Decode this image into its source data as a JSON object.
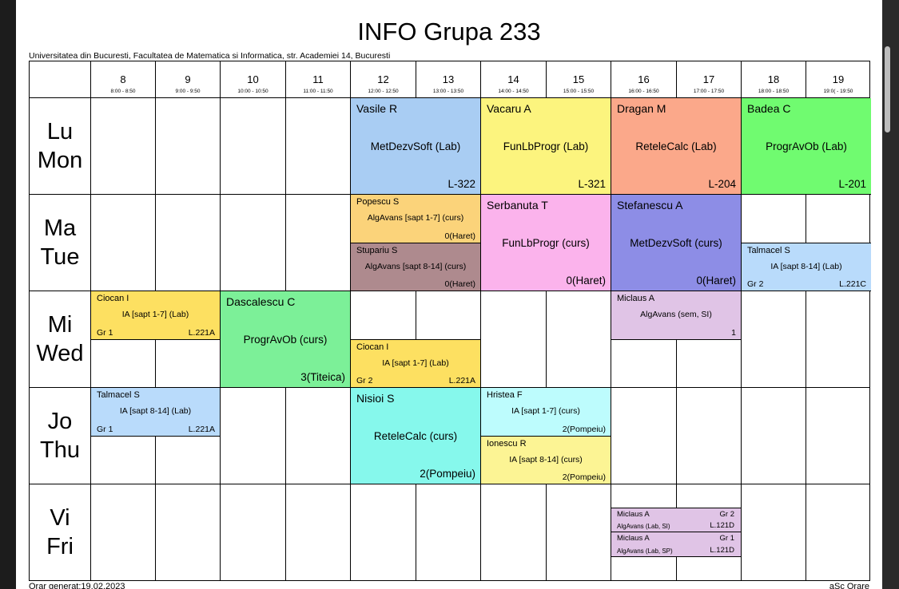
{
  "title": "INFO Grupa 233",
  "subtitle": "Universitatea din Bucuresti, Facultatea de Matematica si Informatica, str. Academiei 14, Bucuresti",
  "hours": [
    {
      "num": "8",
      "time": "8:00 - 8:50"
    },
    {
      "num": "9",
      "time": "9:00 - 9:50"
    },
    {
      "num": "10",
      "time": "10:00 - 10:50"
    },
    {
      "num": "11",
      "time": "11:00 - 11:50"
    },
    {
      "num": "12",
      "time": "12:00 - 12:50"
    },
    {
      "num": "13",
      "time": "13:00 - 13:50"
    },
    {
      "num": "14",
      "time": "14:00 - 14:50"
    },
    {
      "num": "15",
      "time": "15:00 - 15:50"
    },
    {
      "num": "16",
      "time": "16:00 - 16:50"
    },
    {
      "num": "17",
      "time": "17:00 - 17:50"
    },
    {
      "num": "18",
      "time": "18:00 - 18:50"
    },
    {
      "num": "19",
      "time": "19:0( - 19:50"
    }
  ],
  "days": [
    {
      "ro": "Lu",
      "en": "Mon"
    },
    {
      "ro": "Ma",
      "en": "Tue"
    },
    {
      "ro": "Mi",
      "en": "Wed"
    },
    {
      "ro": "Jo",
      "en": "Thu"
    },
    {
      "ro": "Vi",
      "en": "Fri"
    }
  ],
  "activities": {
    "mon_vasile": {
      "prof": "Vasile R",
      "subject": "MetDezvSoft (Lab)",
      "room": "L-322",
      "color": "#a9cdf3"
    },
    "mon_vacaru": {
      "prof": "Vacaru A",
      "subject": "FunLbProgr (Lab)",
      "room": "L-321",
      "color": "#fcf47e"
    },
    "mon_dragan": {
      "prof": "Dragan M",
      "subject": "ReteleCalc (Lab)",
      "room": "L-204",
      "color": "#fba88a"
    },
    "mon_badea": {
      "prof": "Badea C",
      "subject": "ProgrAvOb (Lab)",
      "room": "L-201",
      "color": "#70fb70"
    },
    "tue_popescu": {
      "prof": "Popescu S",
      "subject": "AlgAvans [sapt 1-7] (curs)",
      "room": "0(Haret)",
      "color": "#fbd37a"
    },
    "tue_stupariu": {
      "prof": "Stupariu S",
      "subject": "AlgAvans [sapt 8-14] (curs)",
      "room": "0(Haret)",
      "color": "#ae8a8e"
    },
    "tue_serbanuta": {
      "prof": "Serbanuta T",
      "subject": "FunLbProgr (curs)",
      "room": "0(Haret)",
      "color": "#fbb3ec"
    },
    "tue_stefanescu": {
      "prof": "Stefanescu A",
      "subject": "MetDezvSoft (curs)",
      "room": "0(Haret)",
      "color": "#8d8de6"
    },
    "tue_talmacel": {
      "prof": "Talmacel S",
      "subject": "IA [sapt 8-14] (Lab)",
      "group": "Gr 2",
      "room": "L.221C",
      "color": "#b9dbfb"
    },
    "wed_ciocan1": {
      "prof": "Ciocan I",
      "subject": "IA [sapt 1-7] (Lab)",
      "group": "Gr 1",
      "room": "L.221A",
      "color": "#fde061"
    },
    "wed_dascalescu": {
      "prof": "Dascalescu C",
      "subject": "ProgrAvOb (curs)",
      "room": "3(Titeica)",
      "color": "#7cf098"
    },
    "wed_ciocan2": {
      "prof": "Ciocan I",
      "subject": "IA [sapt 1-7] (Lab)",
      "group": "Gr 2",
      "room": "L.221A",
      "color": "#fde061"
    },
    "wed_miclaus": {
      "prof": "Miclaus A",
      "subject": "AlgAvans (sem, SI)",
      "room": "1",
      "color": "#e0c4e6"
    },
    "thu_talmacel": {
      "prof": "Talmacel S",
      "subject": "IA [sapt 8-14] (Lab)",
      "group": "Gr 1",
      "room": "L.221A",
      "color": "#b9dbfb"
    },
    "thu_nisioi": {
      "prof": "Nisioi S",
      "subject": "ReteleCalc (curs)",
      "room": "2(Pompeiu)",
      "color": "#86f8ec"
    },
    "thu_hristea": {
      "prof": "Hristea F",
      "subject": "IA [sapt 1-7] (curs)",
      "room": "2(Pompeiu)",
      "color": "#bdfcfd"
    },
    "thu_ionescu": {
      "prof": "Ionescu R",
      "subject": "IA [sapt 8-14] (curs)",
      "room": "2(Pompeiu)",
      "color": "#fcf494"
    },
    "fri_miclaus_sl": {
      "prof": "Miclaus A",
      "subject": "AlgAvans (Lab, SI)",
      "group": "Gr 2",
      "room": "L.121D",
      "color": "#e0c4e6"
    },
    "fri_miclaus_sp": {
      "prof": "Miclaus A",
      "subject": "AlgAvans (Lab, SP)",
      "group": "Gr 1",
      "room": "L.121D",
      "color": "#e0c4e6"
    }
  },
  "footer": {
    "left": "Orar generat:19.02.2023",
    "right": "aSc Orare"
  }
}
